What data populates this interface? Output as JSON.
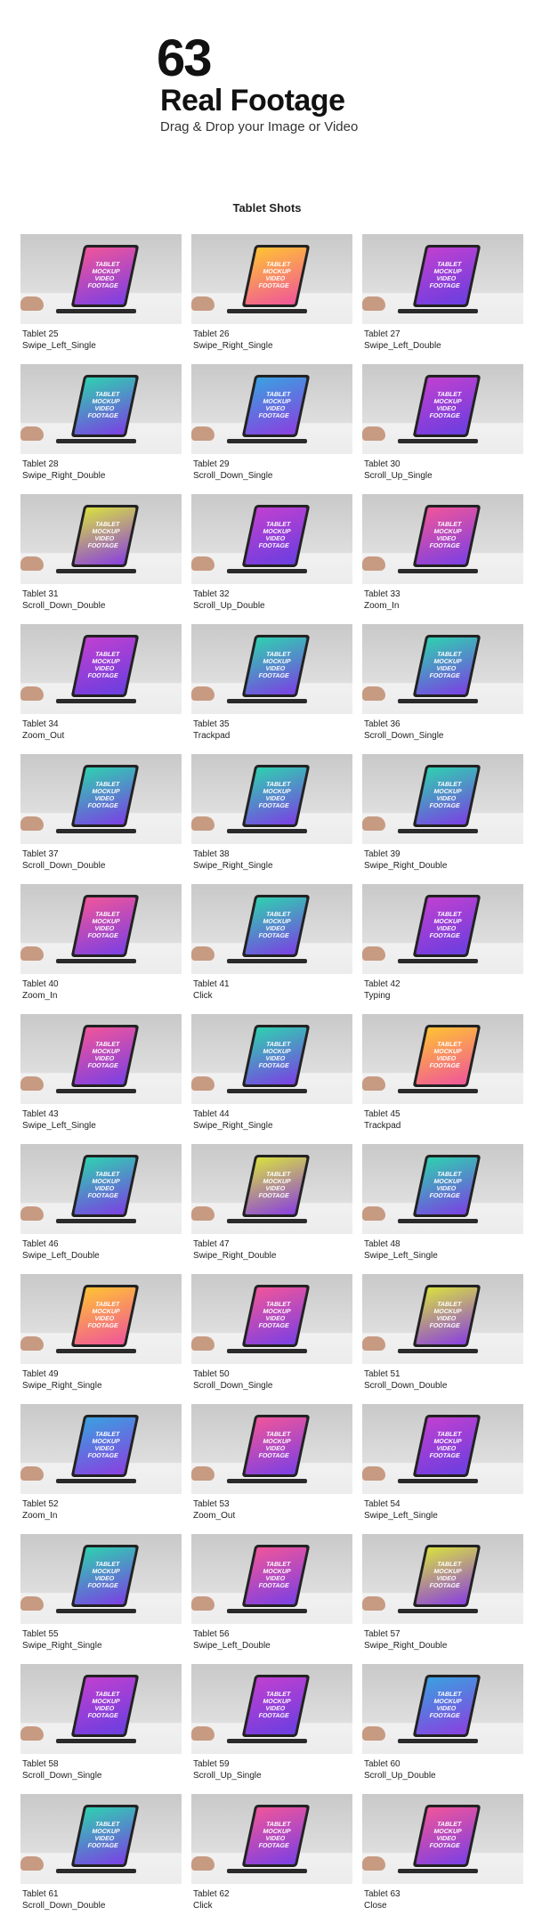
{
  "header": {
    "count": "63",
    "title": "Real Footage",
    "subtitle": "Drag & Drop your Image or Video"
  },
  "section_title": "Tablet Shots",
  "screen_text": [
    "TABLET",
    "MOCKUP",
    "VIDEO",
    "FOOTAGE"
  ],
  "palettes": {
    "pink": [
      "#f0559a",
      "#7b3fe4"
    ],
    "orange": [
      "#ffc233",
      "#f0559a"
    ],
    "purple": [
      "#c040d0",
      "#6a3ee0"
    ],
    "teal": [
      "#2fd0b0",
      "#7b3fe4"
    ],
    "blue": [
      "#3aa0e0",
      "#8a3fe0"
    ],
    "yellow": [
      "#d8e040",
      "#8a3fe0"
    ]
  },
  "items": [
    {
      "name": "Tablet 25",
      "action": "Swipe_Left_Single",
      "screen": "pink"
    },
    {
      "name": "Tablet 26",
      "action": "Swipe_Right_Single",
      "screen": "orange"
    },
    {
      "name": "Tablet 27",
      "action": "Swipe_Left_Double",
      "screen": "purple"
    },
    {
      "name": "Tablet 28",
      "action": "Swipe_Right_Double",
      "screen": "teal"
    },
    {
      "name": "Tablet 29",
      "action": "Scroll_Down_Single",
      "screen": "blue"
    },
    {
      "name": "Tablet 30",
      "action": "Scroll_Up_Single",
      "screen": "purple"
    },
    {
      "name": "Tablet 31",
      "action": "Scroll_Down_Double",
      "screen": "yellow"
    },
    {
      "name": "Tablet 32",
      "action": "Scroll_Up_Double",
      "screen": "purple"
    },
    {
      "name": "Tablet 33",
      "action": "Zoom_In",
      "screen": "pink"
    },
    {
      "name": "Tablet 34",
      "action": "Zoom_Out",
      "screen": "purple"
    },
    {
      "name": "Tablet 35",
      "action": "Trackpad",
      "screen": "teal"
    },
    {
      "name": "Tablet 36",
      "action": "Scroll_Down_Single",
      "screen": "teal"
    },
    {
      "name": "Tablet 37",
      "action": "Scroll_Down_Double",
      "screen": "teal"
    },
    {
      "name": "Tablet 38",
      "action": "Swipe_Right_Single",
      "screen": "teal"
    },
    {
      "name": "Tablet 39",
      "action": "Swipe_Right_Double",
      "screen": "teal"
    },
    {
      "name": "Tablet 40",
      "action": "Zoom_In",
      "screen": "pink"
    },
    {
      "name": "Tablet 41",
      "action": "Click",
      "screen": "teal"
    },
    {
      "name": "Tablet 42",
      "action": "Typing",
      "screen": "purple"
    },
    {
      "name": "Tablet 43",
      "action": "Swipe_Left_Single",
      "screen": "pink"
    },
    {
      "name": "Tablet 44",
      "action": "Swipe_Right_Single",
      "screen": "teal"
    },
    {
      "name": "Tablet 45",
      "action": "Trackpad",
      "screen": "orange"
    },
    {
      "name": "Tablet 46",
      "action": "Swipe_Left_Double",
      "screen": "teal"
    },
    {
      "name": "Tablet 47",
      "action": "Swipe_Right_Double",
      "screen": "yellow"
    },
    {
      "name": "Tablet 48",
      "action": "Swipe_Left_Single",
      "screen": "teal"
    },
    {
      "name": "Tablet 49",
      "action": "Swipe_Right_Single",
      "screen": "orange"
    },
    {
      "name": "Tablet 50",
      "action": "Scroll_Down_Single",
      "screen": "pink"
    },
    {
      "name": "Tablet 51",
      "action": "Scroll_Down_Double",
      "screen": "yellow"
    },
    {
      "name": "Tablet 52",
      "action": "Zoom_In",
      "screen": "blue"
    },
    {
      "name": "Tablet 53",
      "action": "Zoom_Out",
      "screen": "pink"
    },
    {
      "name": "Tablet 54",
      "action": "Swipe_Left_Single",
      "screen": "purple"
    },
    {
      "name": "Tablet 55",
      "action": "Swipe_Right_Single",
      "screen": "teal"
    },
    {
      "name": "Tablet 56",
      "action": "Swipe_Left_Double",
      "screen": "pink"
    },
    {
      "name": "Tablet 57",
      "action": "Swipe_Right_Double",
      "screen": "yellow"
    },
    {
      "name": "Tablet 58",
      "action": "Scroll_Down_Single",
      "screen": "purple"
    },
    {
      "name": "Tablet 59",
      "action": "Scroll_Up_Single",
      "screen": "purple"
    },
    {
      "name": "Tablet 60",
      "action": "Scroll_Up_Double",
      "screen": "blue"
    },
    {
      "name": "Tablet 61",
      "action": "Scroll_Down_Double",
      "screen": "teal"
    },
    {
      "name": "Tablet 62",
      "action": "Click",
      "screen": "pink"
    },
    {
      "name": "Tablet 63",
      "action": "Close",
      "screen": "pink"
    }
  ]
}
